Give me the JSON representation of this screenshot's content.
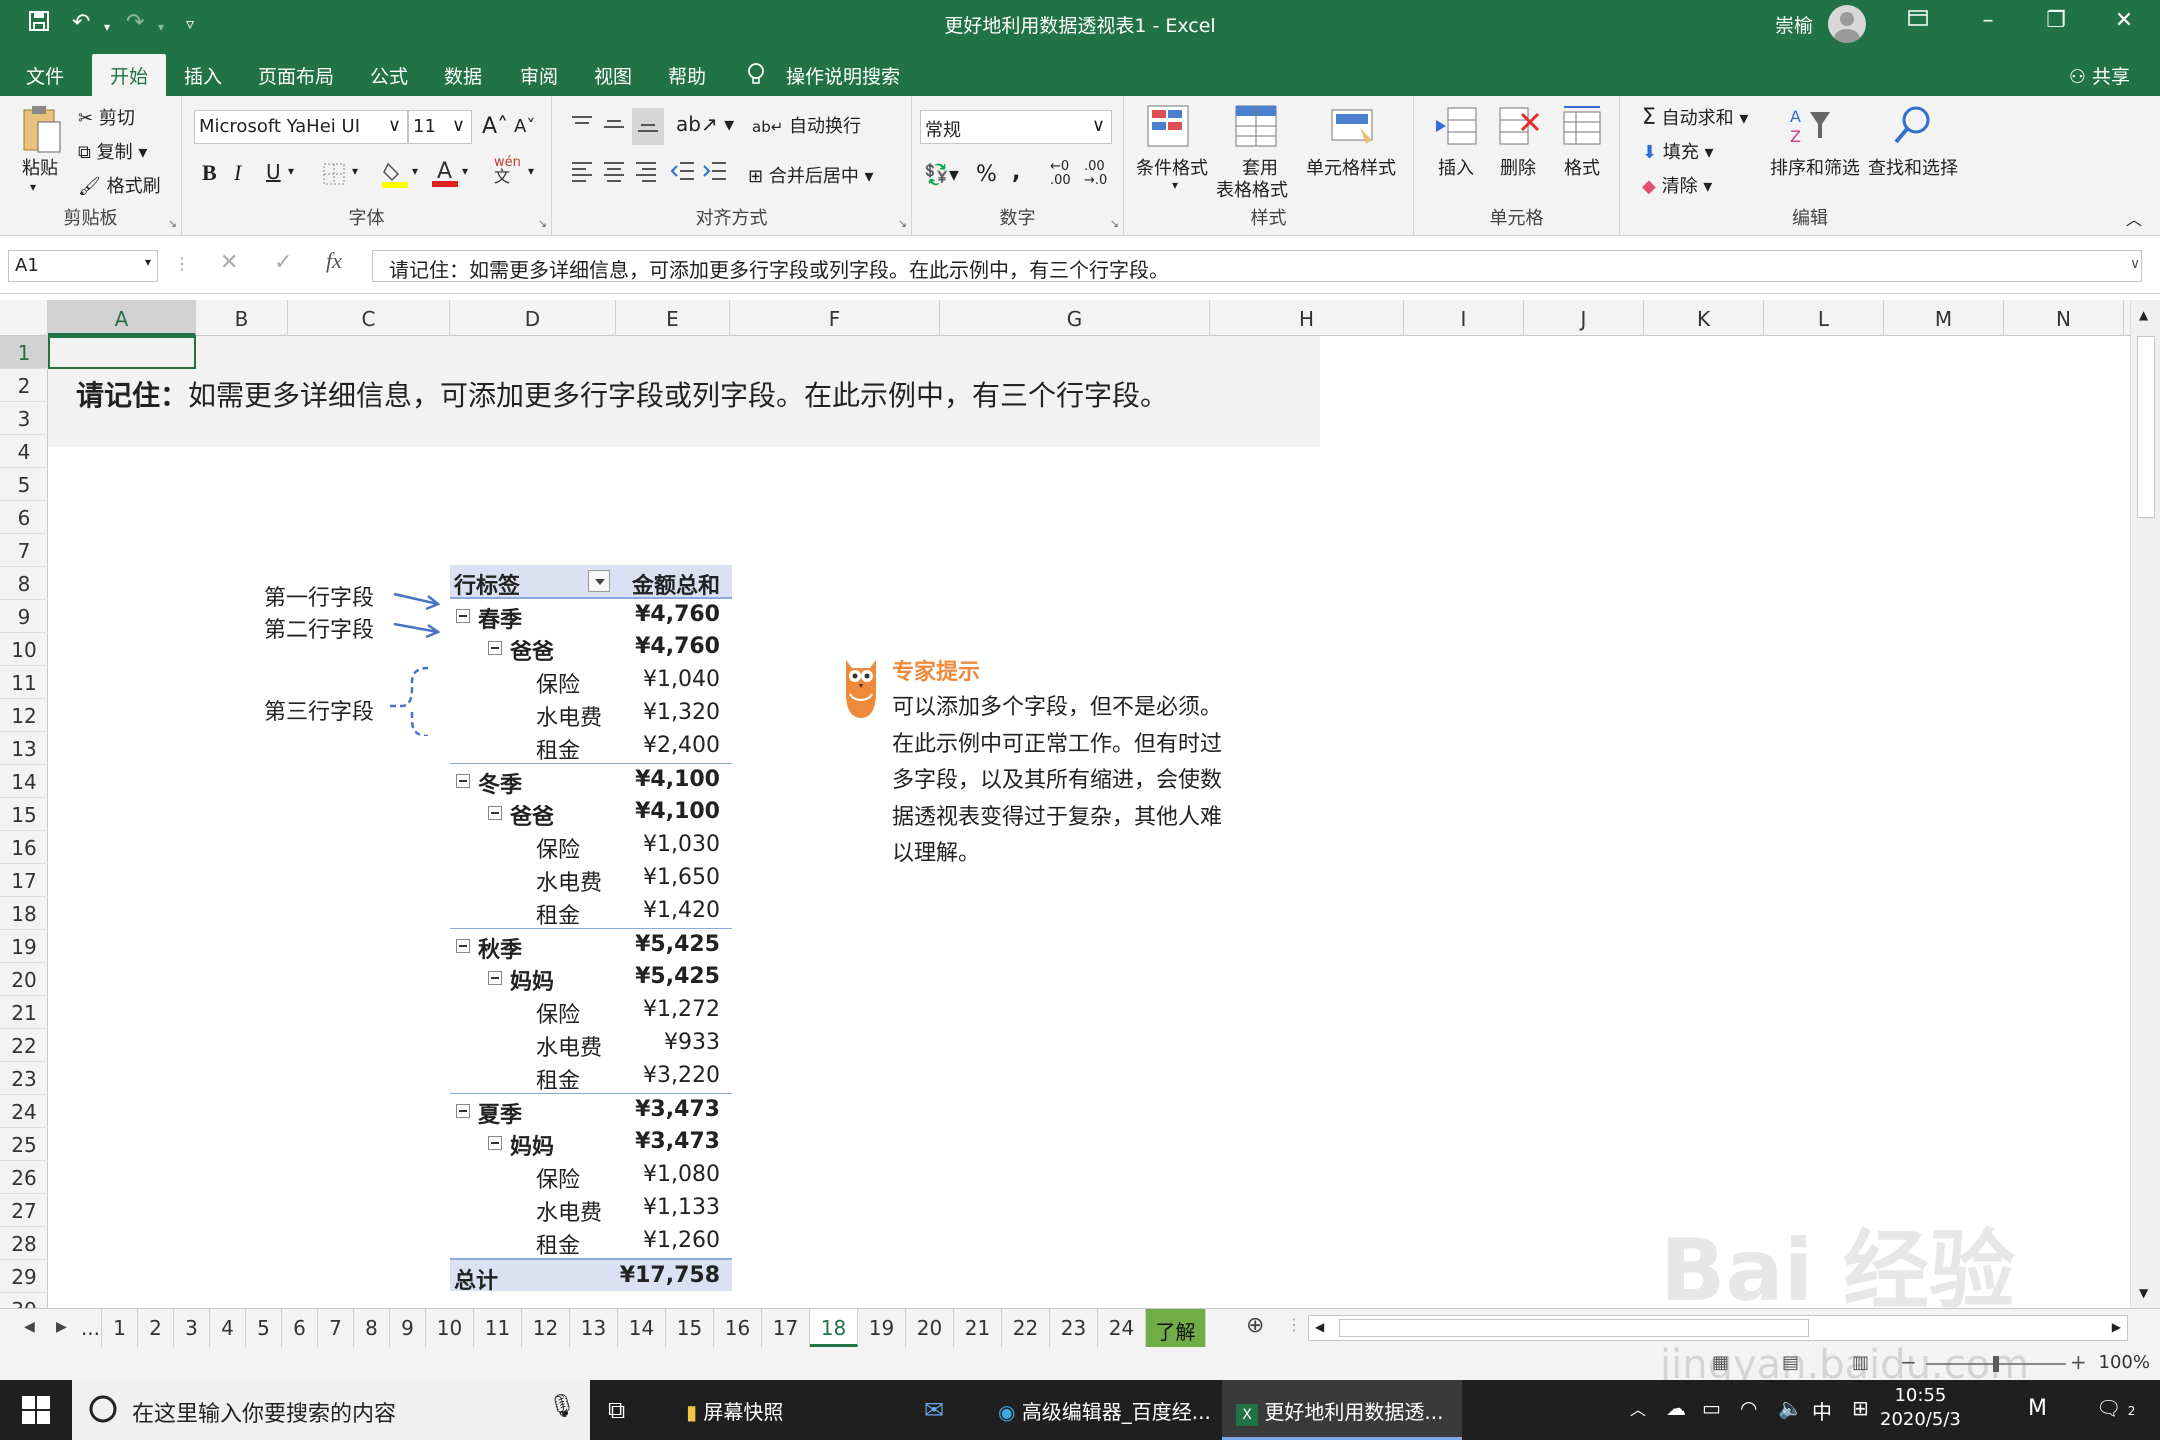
{
  "window": {
    "title": "更好地利用数据透视表1  -  Excel",
    "user": "崇榆"
  },
  "tabs": [
    "文件",
    "开始",
    "插入",
    "页面布局",
    "公式",
    "数据",
    "审阅",
    "视图",
    "帮助",
    "操作说明搜索"
  ],
  "active_tab": "开始",
  "share_label": "共享",
  "ribbon": {
    "clipboard": {
      "paste": "粘贴",
      "cut": "剪切",
      "copy": "复制",
      "format_painter": "格式刷",
      "label": "剪贴板"
    },
    "font": {
      "name": "Microsoft YaHei UI",
      "size": "11",
      "grow": "A",
      "shrink": "A",
      "bold": "B",
      "italic": "I",
      "underline": "U",
      "label": "字体"
    },
    "alignment": {
      "wrap": "自动换行",
      "merge": "合并后居中",
      "label": "对齐方式"
    },
    "number": {
      "format": "常规",
      "label": "数字"
    },
    "styles": {
      "conditional": "条件格式",
      "table_format_1": "套用",
      "table_format_2": "表格格式",
      "cell_styles": "单元格样式",
      "label": "样式"
    },
    "cells": {
      "insert": "插入",
      "delete": "删除",
      "format": "格式",
      "label": "单元格"
    },
    "editing": {
      "autosum": "自动求和",
      "fill": "填充",
      "clear": "清除",
      "sort": "排序和筛选",
      "find": "查找和选择",
      "label": "编辑"
    }
  },
  "formula_bar": {
    "name_box": "A1",
    "content": "请记住：如需更多详细信息，可添加更多行字段或列字段。在此示例中，有三个行字段。"
  },
  "columns": [
    "A",
    "B",
    "C",
    "D",
    "E",
    "F",
    "G",
    "H",
    "I",
    "J",
    "K",
    "L",
    "M",
    "N"
  ],
  "rows": [
    "1",
    "2",
    "3",
    "4",
    "5",
    "6",
    "7",
    "8",
    "9",
    "10",
    "11",
    "12",
    "13",
    "14",
    "15",
    "16",
    "17",
    "18",
    "19",
    "20",
    "21",
    "22",
    "23",
    "24",
    "25",
    "26",
    "27",
    "28",
    "29",
    "30"
  ],
  "note": {
    "bold": "请记住：",
    "text": "如需更多详细信息，可添加更多行字段或列字段。在此示例中，有三个行字段。"
  },
  "annotations": {
    "field1": "第一行字段",
    "field2": "第二行字段",
    "field3": "第三行字段"
  },
  "pivot": {
    "header_label": "行标签",
    "header_value": "金额总和",
    "rows": [
      {
        "level": 1,
        "label": "春季",
        "value": "¥4,760"
      },
      {
        "level": 2,
        "label": "爸爸",
        "value": "¥4,760"
      },
      {
        "level": 3,
        "label": "保险",
        "value": "¥1,040"
      },
      {
        "level": 3,
        "label": "水电费",
        "value": "¥1,320"
      },
      {
        "level": 3,
        "label": "租金",
        "value": "¥2,400"
      },
      {
        "level": 1,
        "label": "冬季",
        "value": "¥4,100"
      },
      {
        "level": 2,
        "label": "爸爸",
        "value": "¥4,100"
      },
      {
        "level": 3,
        "label": "保险",
        "value": "¥1,030"
      },
      {
        "level": 3,
        "label": "水电费",
        "value": "¥1,650"
      },
      {
        "level": 3,
        "label": "租金",
        "value": "¥1,420"
      },
      {
        "level": 1,
        "label": "秋季",
        "value": "¥5,425"
      },
      {
        "level": 2,
        "label": "妈妈",
        "value": "¥5,425"
      },
      {
        "level": 3,
        "label": "保险",
        "value": "¥1,272"
      },
      {
        "level": 3,
        "label": "水电费",
        "value": "¥933"
      },
      {
        "level": 3,
        "label": "租金",
        "value": "¥3,220"
      },
      {
        "level": 1,
        "label": "夏季",
        "value": "¥3,473"
      },
      {
        "level": 2,
        "label": "妈妈",
        "value": "¥3,473"
      },
      {
        "level": 3,
        "label": "保险",
        "value": "¥1,080"
      },
      {
        "level": 3,
        "label": "水电费",
        "value": "¥1,133"
      },
      {
        "level": 3,
        "label": "租金",
        "value": "¥1,260"
      }
    ],
    "total_label": "总计",
    "total_value": "¥17,758"
  },
  "tip": {
    "title": "专家提示",
    "body": "可以添加多个字段，但不是必须。在此示例中可正常工作。但有时过多字段，以及其所有缩进，会使数据透视表变得过于复杂，其他人难以理解。"
  },
  "sheet_tabs": [
    "...",
    "1",
    "2",
    "3",
    "4",
    "5",
    "6",
    "7",
    "8",
    "9",
    "10",
    "11",
    "12",
    "13",
    "14",
    "15",
    "16",
    "17",
    "18",
    "19",
    "20",
    "21",
    "22",
    "23",
    "24",
    "了解 ...",
    "..."
  ],
  "active_sheet": "18",
  "status": {
    "zoom": "100%"
  },
  "taskbar": {
    "search_placeholder": "在这里输入你要搜索的内容",
    "items": [
      "屏幕快照",
      "高级编辑器_百度经...",
      "更好地利用数据透..."
    ],
    "ime": "中",
    "time": "10:55",
    "date": "2020/5/3",
    "notifications": "2"
  },
  "watermark": {
    "brand": "Bai 经验",
    "url": "jingyan.baidu.com"
  },
  "colors": {
    "excel_green": "#217346",
    "pivot_header": "#d9e1f2",
    "tip_orange": "#ee8a3a",
    "arrow_blue": "#4a72c4"
  }
}
